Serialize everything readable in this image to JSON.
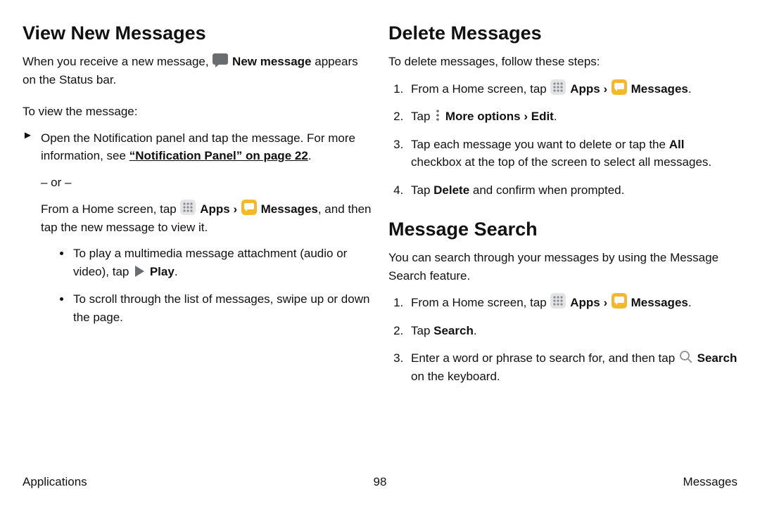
{
  "left": {
    "heading": "View New Messages",
    "intro_pre": "When you receive a new message, ",
    "intro_bold": "New message",
    "intro_post": " appears on the Status bar.",
    "view_lead": "To view the message:",
    "step1_a": "Open the Notification panel and tap the message. For more information, see ",
    "step1_link": "“Notification Panel” on page 22",
    "step1_dot": ".",
    "or": "– or –",
    "step2_a": "From a Home screen, tap ",
    "step2_apps": "Apps",
    "step2_msgs": "Messages",
    "step2_tail": ", and then tap the new message to view it.",
    "sub1_a": "To play a multimedia message attachment (audio or video), tap ",
    "sub1_play": "Play",
    "sub1_dot": ".",
    "sub2": "To scroll through the list of messages, swipe up or down the page."
  },
  "right_a": {
    "heading": "Delete Messages",
    "intro": "To delete messages, follow these steps:",
    "s1_a": "From a Home screen, tap ",
    "s1_apps": "Apps",
    "s1_msgs": "Messages",
    "s1_dot": ".",
    "s2_a": "Tap ",
    "s2_more": "More options",
    "s2_edit": "Edit",
    "s2_dot": ".",
    "s3_a": "Tap each message you want to delete or tap the ",
    "s3_all": "All",
    "s3_b": " checkbox at the top of the screen to select all messages.",
    "s4_a": "Tap ",
    "s4_del": "Delete",
    "s4_b": " and confirm when prompted."
  },
  "right_b": {
    "heading": "Message Search",
    "intro": "You can search through your messages by using the Message Search feature.",
    "s1_a": "From a Home screen, tap ",
    "s1_apps": "Apps",
    "s1_msgs": "Messages",
    "s1_dot": ".",
    "s2_a": "Tap ",
    "s2_srch": "Search",
    "s2_dot": ".",
    "s3_a": "Enter a word or phrase to search for, and then tap ",
    "s3_srch": "Search",
    "s3_b": " on the keyboard."
  },
  "chevron": "›",
  "footer": {
    "left": "Applications",
    "page": "98",
    "right": "Messages"
  }
}
